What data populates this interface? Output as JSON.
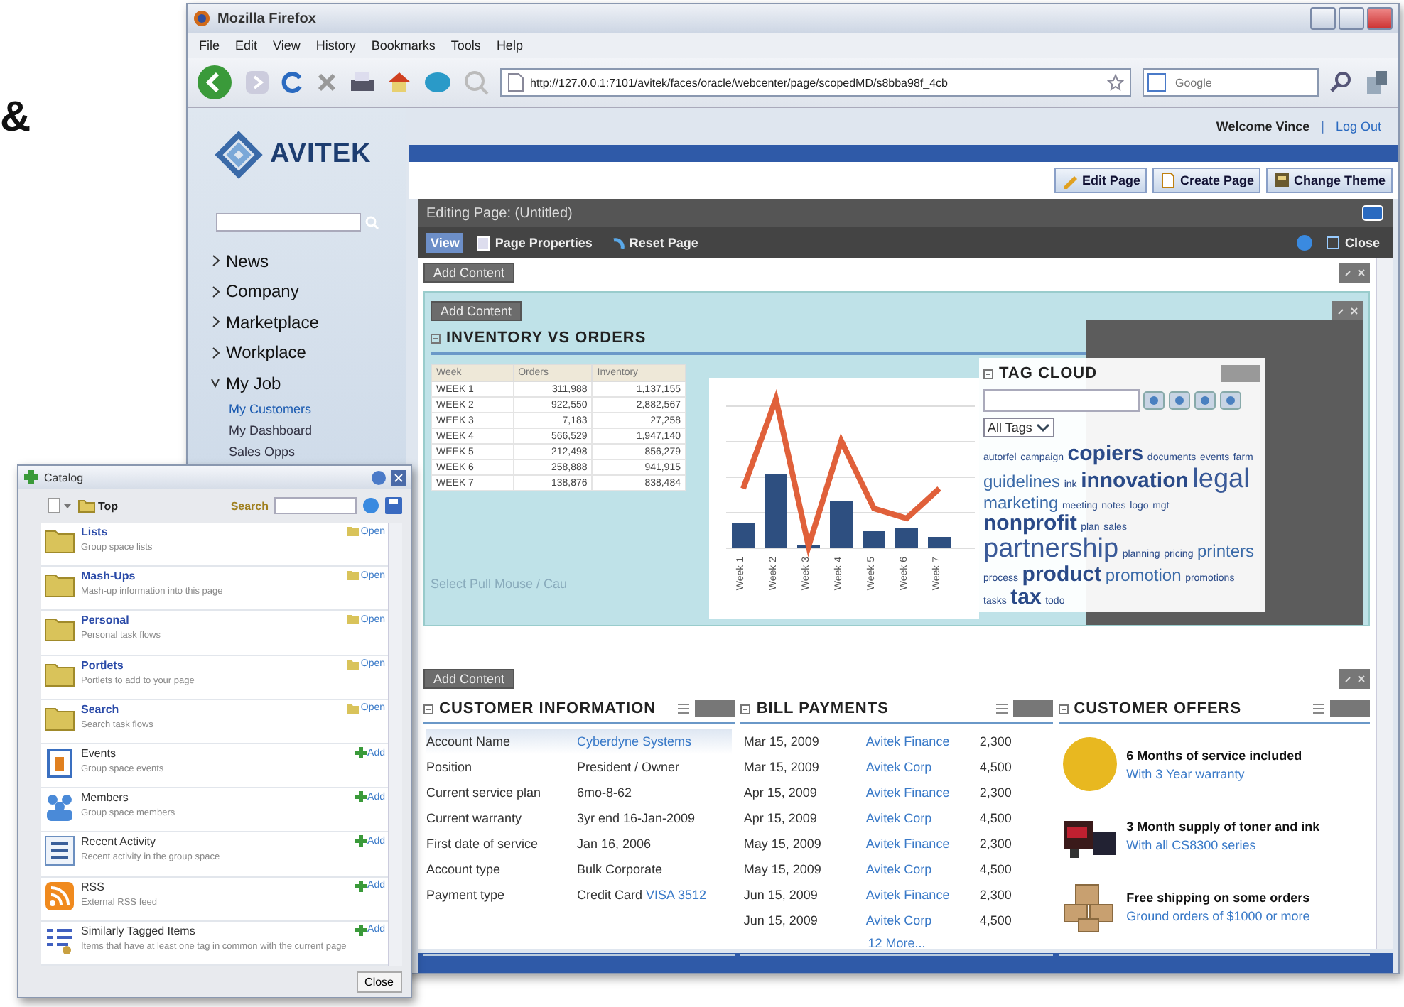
{
  "side_text": "&",
  "browser": {
    "title": "Mozilla Firefox",
    "menu": [
      "File",
      "Edit",
      "View",
      "History",
      "Bookmarks",
      "Tools",
      "Help"
    ],
    "url": "http://127.0.0.1:7101/avitek/faces/oracle/webcenter/page/scopedMD/s8bba98f_4cb",
    "search": {
      "placeholder": "Google"
    }
  },
  "site": {
    "logo": "AVITEK",
    "nav": [
      {
        "label": "News",
        "expanded": false
      },
      {
        "label": "Company",
        "expanded": false
      },
      {
        "label": "Marketplace",
        "expanded": false
      },
      {
        "label": "Workplace",
        "expanded": false
      },
      {
        "label": "My Job",
        "expanded": true,
        "children": [
          {
            "label": "My Customers",
            "selected": true
          },
          {
            "label": "My Dashboard",
            "selected": false
          },
          {
            "label": "Sales Opps",
            "selected": false
          }
        ]
      }
    ],
    "welcome": "Welcome Vince",
    "separator": "|",
    "logout": "Log Out",
    "page_buttons": [
      "Edit Page",
      "Create Page",
      "Change Theme"
    ]
  },
  "editor": {
    "title": "Editing Page: (Untitled)",
    "toolbar": [
      {
        "label": "View",
        "selected": true
      },
      {
        "label": "Page Properties",
        "selected": false
      },
      {
        "label": "Reset Page",
        "selected": false
      }
    ],
    "close": "Close",
    "add_content": "Add Content"
  },
  "inventory": {
    "title": "INVENTORY VS ORDERS",
    "add_content": "Add Content",
    "columns": [
      "Week",
      "Orders",
      "Inventory"
    ],
    "rows": [
      [
        "WEEK 1",
        "311,988",
        "1,137,155"
      ],
      [
        "WEEK 2",
        "922,550",
        "2,882,567"
      ],
      [
        "WEEK 3",
        "7,183",
        "27,258"
      ],
      [
        "WEEK 4",
        "566,529",
        "1,947,140"
      ],
      [
        "WEEK 5",
        "212,498",
        "856,279"
      ],
      [
        "WEEK 6",
        "258,888",
        "941,915"
      ],
      [
        "WEEK 7",
        "138,876",
        "838,484"
      ]
    ],
    "chart_labels": [
      "Week 1",
      "Week 2",
      "Week 3",
      "Week 4",
      "Week 5",
      "Week 6",
      "Week 7"
    ],
    "caption": "Select Pull Mouse / Cau"
  },
  "tag_cloud": {
    "title": "TAG CLOUD",
    "filter": "All Tags",
    "tags": [
      {
        "label": "autorfel",
        "kind": "small"
      },
      {
        "label": "campaign",
        "kind": "small"
      },
      {
        "label": "copiers",
        "kind": "large"
      },
      {
        "label": "documents",
        "kind": "small"
      },
      {
        "label": "events",
        "kind": "small"
      },
      {
        "label": "farm",
        "kind": "small"
      },
      {
        "label": "guidelines",
        "kind": "medium"
      },
      {
        "label": "ink",
        "kind": "small"
      },
      {
        "label": "innovation",
        "kind": "large"
      },
      {
        "label": "legal",
        "kind": "huge"
      },
      {
        "label": "marketing",
        "kind": "medium"
      },
      {
        "label": "meeting",
        "kind": "small"
      },
      {
        "label": "notes",
        "kind": "small"
      },
      {
        "label": "logo",
        "kind": "small"
      },
      {
        "label": "mgt",
        "kind": "small"
      },
      {
        "label": "nonprofit",
        "kind": "large"
      },
      {
        "label": "plan",
        "kind": "small"
      },
      {
        "label": "sales",
        "kind": "small"
      },
      {
        "label": "partnership",
        "kind": "huge"
      },
      {
        "label": "planning",
        "kind": "small"
      },
      {
        "label": "pricing",
        "kind": "small"
      },
      {
        "label": "printers",
        "kind": "medium"
      },
      {
        "label": "process",
        "kind": "small"
      },
      {
        "label": "product",
        "kind": "large"
      },
      {
        "label": "promotion",
        "kind": "medium"
      },
      {
        "label": "promotions",
        "kind": "small"
      },
      {
        "label": "tasks",
        "kind": "small"
      },
      {
        "label": "tax",
        "kind": "large"
      },
      {
        "label": "todo",
        "kind": "small"
      }
    ]
  },
  "bottom_add_content": "Add Content",
  "customer_info": {
    "title": "CUSTOMER INFORMATION",
    "rows": [
      {
        "label": "Account Name",
        "value": "Cyberdyne Systems",
        "link": ""
      },
      {
        "label": "Position",
        "value": "President / Owner",
        "link": ""
      },
      {
        "label": "Current service plan",
        "value": "6mo-8-62",
        "link": ""
      },
      {
        "label": "Current warranty",
        "value": "3yr end 16-Jan-2009",
        "link": ""
      },
      {
        "label": "First date of service",
        "value": "Jan 16, 2006",
        "link": ""
      },
      {
        "label": "Account type",
        "value": "Bulk Corporate",
        "link": ""
      },
      {
        "label": "Payment type",
        "value": "Credit Card",
        "link": "VISA 3512"
      }
    ]
  },
  "bill_payments": {
    "title": "BILL PAYMENTS",
    "rows": [
      [
        "Mar 15, 2009",
        "Avitek Finance",
        "2,300"
      ],
      [
        "Mar 15, 2009",
        "Avitek Corp",
        "4,500"
      ],
      [
        "Apr 15, 2009",
        "Avitek Finance",
        "2,300"
      ],
      [
        "Apr 15, 2009",
        "Avitek Corp",
        "4,500"
      ],
      [
        "May 15, 2009",
        "Avitek Finance",
        "2,300"
      ],
      [
        "May 15, 2009",
        "Avitek Corp",
        "4,500"
      ],
      [
        "Jun 15, 2009",
        "Avitek Finance",
        "2,300"
      ],
      [
        "Jun 15, 2009",
        "Avitek Corp",
        "4,500"
      ]
    ],
    "more": "12 More..."
  },
  "offers": {
    "title": "CUSTOMER OFFERS",
    "items": [
      {
        "kind": "disc",
        "title": "6 Months of service included",
        "subtitle": "With 3 Year warranty"
      },
      {
        "kind": "printer",
        "title": "3 Month supply of toner and ink",
        "subtitle": "With all CS8300 series"
      },
      {
        "kind": "boxes",
        "title": "Free shipping on some orders",
        "subtitle": "Ground orders of $1000 or more"
      }
    ]
  },
  "catalog": {
    "title": "Catalog",
    "location": "Top",
    "search_label": "Search",
    "items": [
      {
        "kind": "folder",
        "name": "Lists",
        "description": "Group space lists",
        "action": "Open"
      },
      {
        "kind": "folder",
        "name": "Mash-Ups",
        "description": "Mash-up information into this page",
        "action": "Open"
      },
      {
        "kind": "folder",
        "name": "Personal",
        "description": "Personal task flows",
        "action": "Open"
      },
      {
        "kind": "folder",
        "name": "Portlets",
        "description": "Portlets to add to your page",
        "action": "Open"
      },
      {
        "kind": "folder",
        "name": "Search",
        "description": "Search task flows",
        "action": "Open"
      },
      {
        "kind": "calendar",
        "name": "Events",
        "description": "Group space events",
        "action": "Add"
      },
      {
        "kind": "people",
        "name": "Members",
        "description": "Group space members",
        "action": "Add"
      },
      {
        "kind": "list",
        "name": "Recent Activity",
        "description": "Recent activity in the group space",
        "action": "Add"
      },
      {
        "kind": "rss",
        "name": "RSS",
        "description": "External RSS feed",
        "action": "Add"
      },
      {
        "kind": "tagged",
        "name": "Similarly Tagged Items",
        "description": "Items that have at least one tag in common with the current page",
        "action": "Add"
      }
    ],
    "close": "Close"
  }
}
